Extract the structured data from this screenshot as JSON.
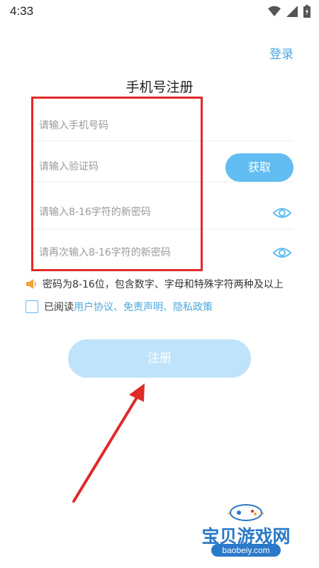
{
  "status_bar": {
    "time": "4:33"
  },
  "header": {
    "login_label": "登录",
    "title": "手机号注册"
  },
  "form": {
    "phone_placeholder": "请输入手机号码",
    "code_placeholder": "请输入验证码",
    "get_code_label": "获取",
    "password_placeholder": "请输入8-16字符的新密码",
    "confirm_placeholder": "请再次输入8-16字符的新密码"
  },
  "hint": {
    "text": "密码为8-16位，包含数字、字母和特殊字符两种及以上"
  },
  "agreement": {
    "prefix": "已阅读",
    "link1": "用户协议",
    "sep1": "、",
    "link2": "免责声明",
    "sep2": "、",
    "link3": "隐私政策",
    "checked": false
  },
  "register_label": "注册",
  "watermark": {
    "name": "宝贝游戏网",
    "url": "baobeiy.com"
  },
  "colors": {
    "accent": "#62bdf3",
    "link": "#4aa8e0",
    "annotation": "#e02a2a"
  }
}
